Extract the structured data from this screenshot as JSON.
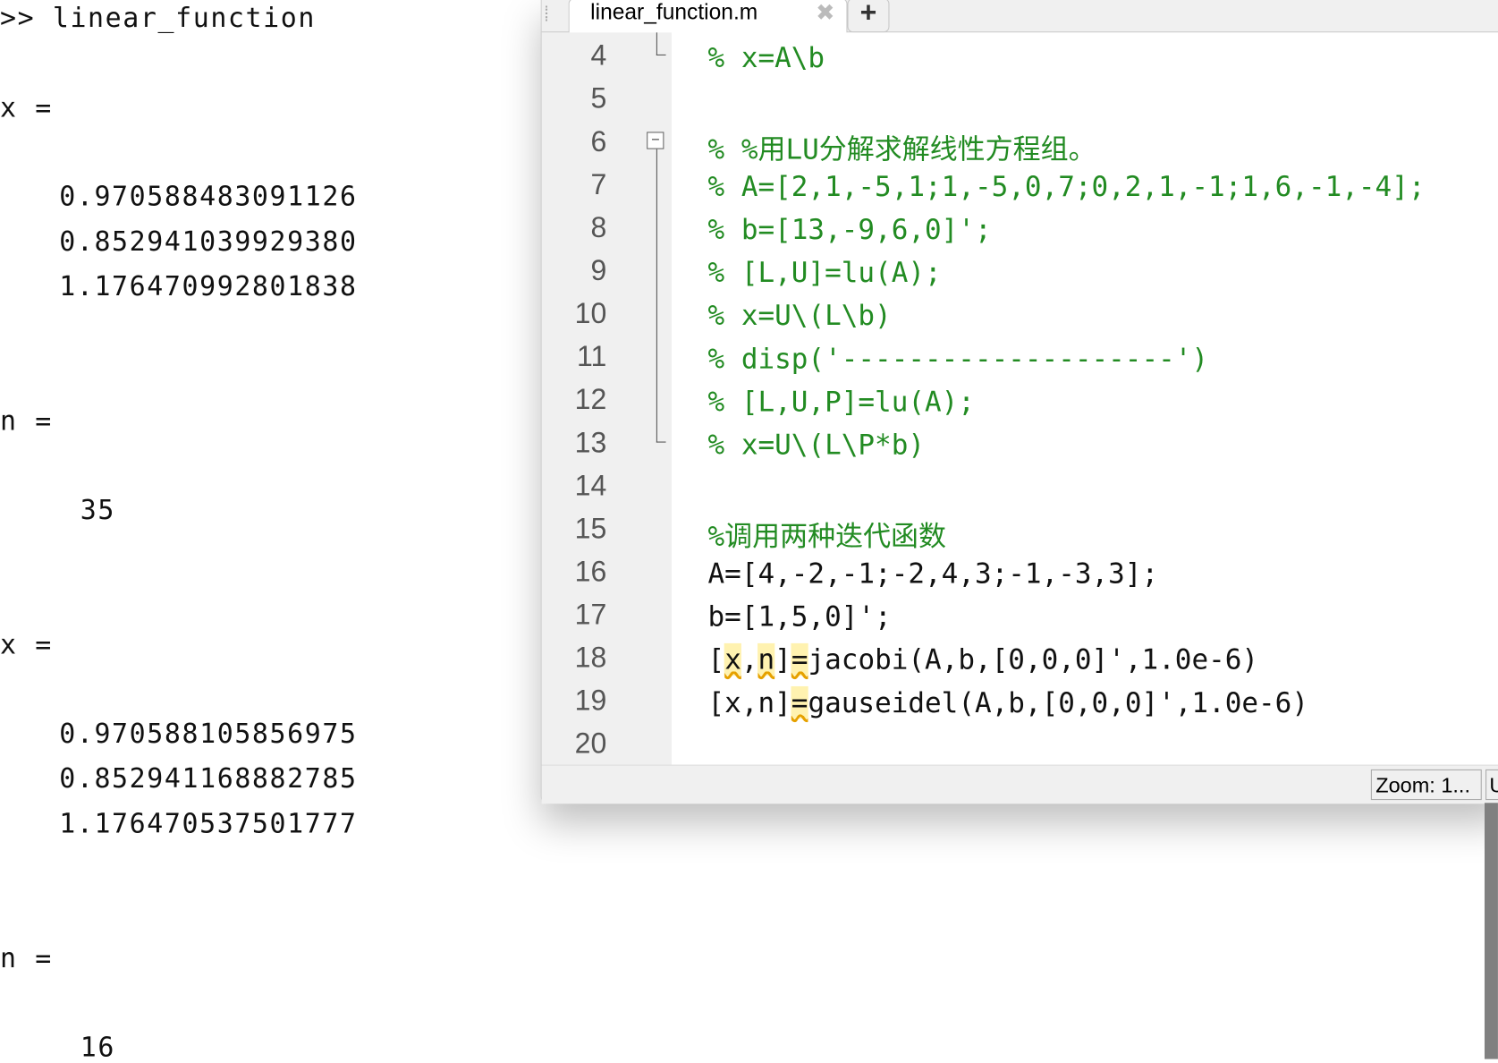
{
  "command_window": {
    "lines": [
      ">> linear_function",
      "x =",
      "0.970588483091126",
      "0.852941039929380",
      "1.176470992801838",
      "n =",
      "35",
      "x =",
      "0.970588105856975",
      "0.852941168882785",
      "1.176470537501777",
      "n =",
      "16"
    ]
  },
  "editor": {
    "tab_label": "linear_function.m",
    "close_icon": "close-icon",
    "add_tab_label": "+",
    "line_numbers": [
      "4",
      "5",
      "6",
      "7",
      "8",
      "9",
      "10",
      "11",
      "12",
      "13",
      "14",
      "15",
      "16",
      "17",
      "18",
      "19",
      "20"
    ],
    "code_lines": [
      "% x=A\\b",
      "",
      "% %用LU分解求解线性方程组。",
      "% A=[2,1,-5,1;1,-5,0,7;0,2,1,-1;1,6,-1,-4];",
      "% b=[13,-9,6,0]';",
      "% [L,U]=lu(A);",
      "% x=U\\(L\\b)",
      "% disp('--------------------')",
      "% [L,U,P]=lu(A);",
      "% x=U\\(L\\P*b)",
      "",
      "%调用两种迭代函数",
      "A=[4,-2,-1;-2,4,3;-1,-3,3];",
      "b=[1,5,0]';",
      "[x,n]=jacobi(A,b,[0,0,0]',1.0e-6)",
      "[x,n]=gauseidel(A,b,[0,0,0]',1.0e-6)",
      ""
    ],
    "line18": {
      "p1": "[",
      "x": "x",
      "p2": ",",
      "n": "n",
      "p3": "]",
      "eq": "=",
      "rest": "jacobi(A,b,[0,0,0]',1.0e-6)"
    },
    "line19": {
      "p1": "[x,n]",
      "eq": "=",
      "rest": "gauseidel(A,b,[0,0,0]',1.0e-6)"
    },
    "comment_color": "#228b22"
  },
  "status": {
    "zoom": "Zoom: 1...",
    "encoding": "U"
  }
}
